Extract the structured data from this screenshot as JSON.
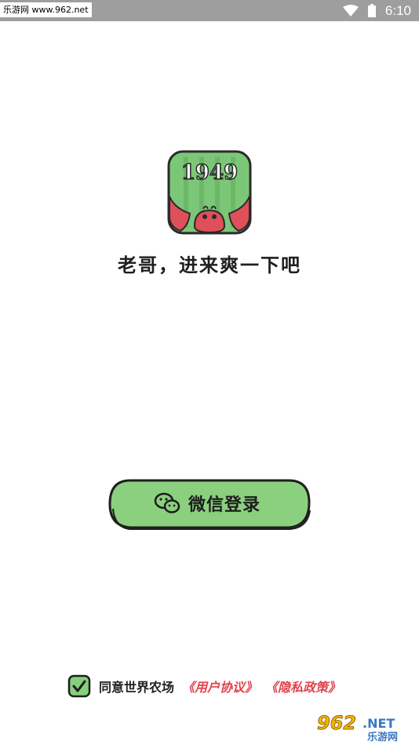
{
  "status_bar": {
    "watermark": "乐游网 www.962.net",
    "time": "6:10"
  },
  "logo": {
    "text": "1949"
  },
  "slogan": "老哥，进来爽一下吧",
  "login": {
    "wechat_label": "微信登录"
  },
  "agreement": {
    "checked": true,
    "prefix": "同意世界农场",
    "user_agreement": "《用户协议》",
    "privacy_policy": "《隐私政策》"
  },
  "watermark_bottom": {
    "number": "962",
    "suffix": ".NET",
    "name": "乐游网"
  },
  "colors": {
    "accent_green": "#86cf7c",
    "link_red": "#e2434f"
  }
}
